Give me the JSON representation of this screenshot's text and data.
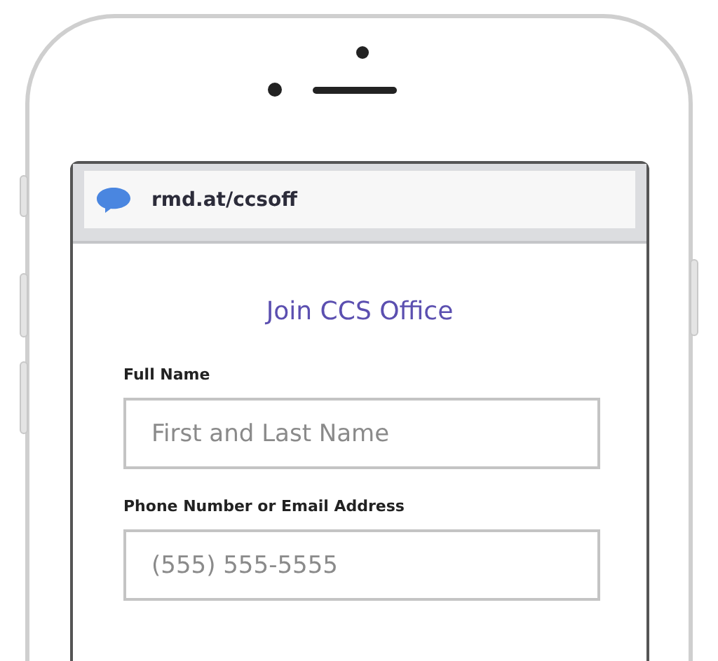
{
  "browser": {
    "url": "rmd.at/ccsoff"
  },
  "form": {
    "title": "Join CCS Office",
    "fields": [
      {
        "label": "Full Name",
        "placeholder": "First and Last Name"
      },
      {
        "label": "Phone Number or Email Address",
        "placeholder": "(555) 555-5555"
      }
    ]
  }
}
